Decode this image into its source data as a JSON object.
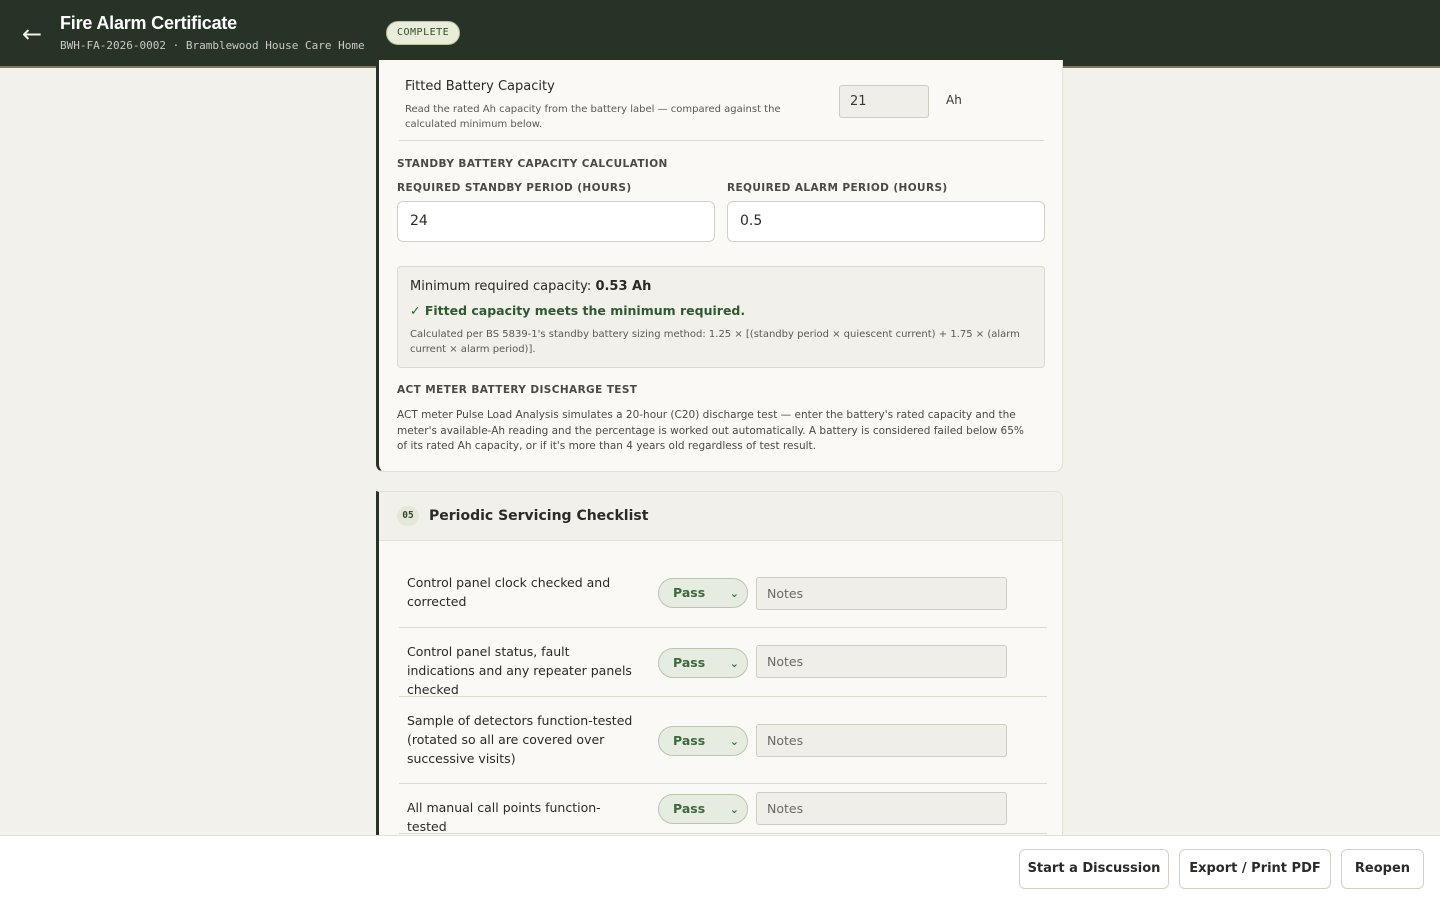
{
  "header": {
    "back_icon": "arrow-left-icon",
    "title": "Fire Alarm Certificate",
    "subtitle": "BWH-FA-2026-0002 · Bramblewood House Care Home",
    "status": "COMPLETE"
  },
  "battery": {
    "fitted_label": "Fitted Battery Capacity",
    "fitted_help": "Read the rated Ah capacity from the battery label — compared against the calculated minimum below.",
    "fitted_value": "21",
    "fitted_unit": "Ah",
    "calc_heading": "STANDBY BATTERY CAPACITY CALCULATION",
    "standby_label": "REQUIRED STANDBY PERIOD (HOURS)",
    "standby_value": "24",
    "alarm_label": "REQUIRED ALARM PERIOD (HOURS)",
    "alarm_value": "0.5",
    "result_prefix": "Minimum required capacity: ",
    "result_value": "0.53 Ah",
    "result_ok": "✓ Fitted capacity meets the minimum required.",
    "result_note": "Calculated per BS 5839-1's standby battery sizing method: 1.25 × [(standby period × quiescent current) + 1.75 × (alarm current × alarm period)].",
    "act_heading": "ACT METER BATTERY DISCHARGE TEST",
    "act_text": "ACT meter Pulse Load Analysis simulates a 20-hour (C20) discharge test — enter the battery's rated capacity and the meter's available-Ah reading and the percentage is worked out automatically. A battery is considered failed below 65% of its rated Ah capacity, or if it's more than 4 years old regardless of test result."
  },
  "servicing": {
    "number": "05",
    "title": "Periodic Servicing Checklist",
    "notes_placeholder": "Notes",
    "items": [
      {
        "label": "Control panel clock checked and corrected",
        "result": "Pass"
      },
      {
        "label": "Control panel status, fault indications and any repeater panels checked",
        "result": "Pass"
      },
      {
        "label": "Sample of detectors function-tested (rotated so all are covered over successive visits)",
        "result": "Pass"
      },
      {
        "label": "All manual call points function-tested",
        "result": "Pass"
      }
    ]
  },
  "footer": {
    "discussion": "Start a Discussion",
    "export": "Export / Print PDF",
    "reopen": "Reopen"
  }
}
